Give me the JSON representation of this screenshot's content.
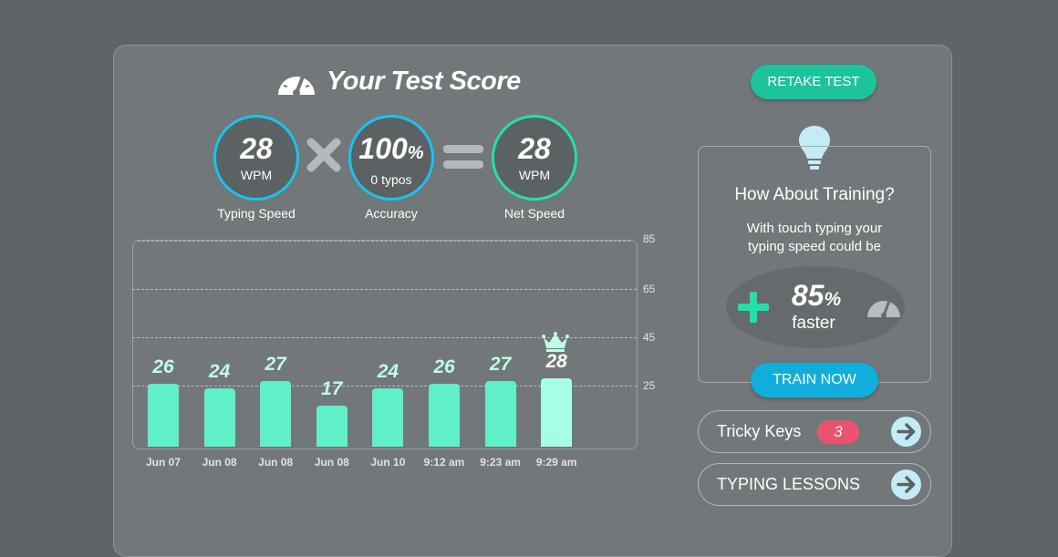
{
  "header": {
    "title": "Your Test Score",
    "icon": "speedometer-icon"
  },
  "score": {
    "typing_speed": {
      "value": "28",
      "unit": "WPM",
      "caption": "Typing Speed"
    },
    "accuracy": {
      "value": "100",
      "pct": "%",
      "unit": "0 typos",
      "caption": "Accuracy"
    },
    "net_speed": {
      "value": "28",
      "unit": "WPM",
      "caption": "Net Speed"
    }
  },
  "chart_data": {
    "type": "bar",
    "categories": [
      "Jun 07",
      "Jun 08",
      "Jun 08",
      "Jun 08",
      "Jun 10",
      "9:12 am",
      "9:23 am",
      "9:29 am"
    ],
    "values": [
      26,
      24,
      27,
      17,
      24,
      26,
      27,
      28
    ],
    "y_ticks": [
      85,
      65,
      45,
      25
    ],
    "ylim": [
      0,
      85
    ],
    "grid": true,
    "highlight_index": 7,
    "colors": {
      "bar": "#5ff0c9",
      "latest": "#a6ffe4"
    }
  },
  "actions": {
    "retake": "RETAKE TEST",
    "train_now": "TRAIN NOW"
  },
  "training": {
    "title": "How About Training?",
    "line1": "With touch typing your",
    "line2": "typing speed could be",
    "boost_value": "85",
    "boost_pct": "%",
    "boost_word": "faster"
  },
  "links": {
    "tricky_keys": {
      "label": "Tricky Keys",
      "count": "3"
    },
    "lessons": {
      "label": "TYPING LESSONS"
    }
  },
  "colors": {
    "blue": "#19c3ee",
    "green": "#22dfae",
    "retake": "#1dc49b",
    "train": "#10aedc",
    "badge": "#ea5370"
  }
}
